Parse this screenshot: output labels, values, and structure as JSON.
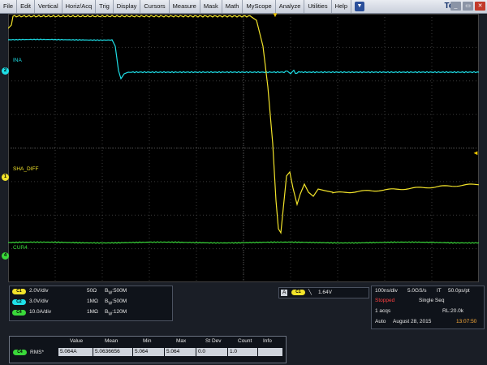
{
  "menu": {
    "items": [
      "File",
      "Edit",
      "Vertical",
      "Horiz/Acq",
      "Trig",
      "Display",
      "Cursors",
      "Measure",
      "Mask",
      "Math",
      "MyScope",
      "Analyze",
      "Utilities",
      "Help"
    ],
    "brand": "Tek"
  },
  "colors": {
    "ch1": "#f2e32a",
    "ch2": "#1ee0e8",
    "ch4": "#3ad83a",
    "trigger": "#f0c800",
    "stopped": "#ff4040",
    "time": "#ffae3a"
  },
  "traces": {
    "ch2": {
      "label": "INA",
      "marker": "2"
    },
    "ch1": {
      "label": "SHA_DIFF",
      "marker": "1"
    },
    "ch4": {
      "label": "CUR4",
      "marker": "4"
    }
  },
  "channels": [
    {
      "chip": "C1",
      "scale": "2.0V/div",
      "coupling": "50Ω",
      "bw": "500M"
    },
    {
      "chip": "C2",
      "scale": "3.0V/div",
      "coupling": "1MΩ",
      "bw": "500M"
    },
    {
      "chip": "C4",
      "scale": "10.0A/div",
      "coupling": "1MΩ",
      "bw": "120M"
    }
  ],
  "bw_prefix": "B",
  "bw_sub": "W",
  "bw_colon": ":",
  "trigger": {
    "mode": "A",
    "chip": "C1",
    "level": "1.64V"
  },
  "acq": {
    "timebase": "100ns/div",
    "rate": "5.0GS/s",
    "it": "IT",
    "it_val": "50.0ps/pt",
    "state": "Stopped",
    "seq": "Single Seq",
    "acqs": "1 acqs",
    "rl": "RL:20.0k",
    "mode": "Auto",
    "date": "August 28, 2015",
    "time": "13:07:50"
  },
  "measure": {
    "headers": [
      "Value",
      "Mean",
      "Min",
      "Max",
      "St Dev",
      "Count",
      "Info"
    ],
    "chip": "C4",
    "name": "RMS*",
    "values": [
      "5.064A",
      "5.0636656",
      "5.064",
      "5.064",
      "0.0",
      "1.0",
      ""
    ]
  }
}
